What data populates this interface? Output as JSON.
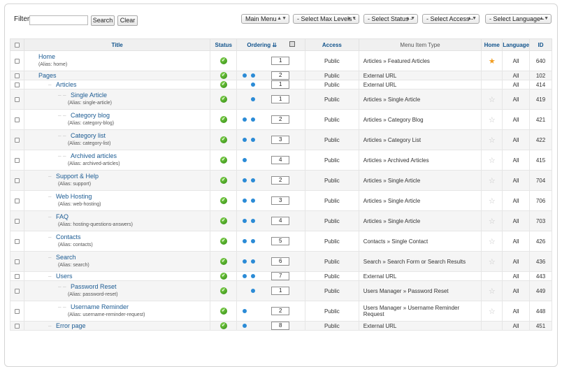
{
  "filter": {
    "label": "Filter:",
    "value": "",
    "search_label": "Search",
    "clear_label": "Clear"
  },
  "selects": {
    "menu": "Main Menu",
    "max_levels": "- Select Max Levels -",
    "status": "- Select Status -",
    "access": "- Select Access -",
    "language": "- Select Language -"
  },
  "columns": {
    "title": "Title",
    "status": "Status",
    "ordering": "Ordering",
    "access": "Access",
    "type": "Menu Item Type",
    "home": "Home",
    "language": "Language",
    "id": "ID"
  },
  "rows": [
    {
      "title": "Home",
      "alias": "(Alias: home)",
      "level": 0,
      "up": false,
      "down": false,
      "order": "1",
      "access": "Public",
      "type": "Articles » Featured Articles",
      "home": "gold",
      "lang": "All",
      "id": "640"
    },
    {
      "title": "Pages",
      "alias": "",
      "level": 0,
      "up": true,
      "down": true,
      "order": "2",
      "access": "Public",
      "type": "External URL",
      "home": "none",
      "lang": "All",
      "id": "102"
    },
    {
      "title": "Articles",
      "alias": "",
      "level": 1,
      "up": false,
      "down": true,
      "order": "1",
      "access": "Public",
      "type": "External URL",
      "home": "none",
      "lang": "All",
      "id": "414"
    },
    {
      "title": "Single Article",
      "alias": "(Alias: single-article)",
      "level": 2,
      "up": false,
      "down": true,
      "order": "1",
      "access": "Public",
      "type": "Articles » Single Article",
      "home": "empty",
      "lang": "All",
      "id": "419"
    },
    {
      "title": "Category blog",
      "alias": "(Alias: category-blog)",
      "level": 2,
      "up": true,
      "down": true,
      "order": "2",
      "access": "Public",
      "type": "Articles » Category Blog",
      "home": "empty",
      "lang": "All",
      "id": "421"
    },
    {
      "title": "Category list",
      "alias": "(Alias: category-list)",
      "level": 2,
      "up": true,
      "down": true,
      "order": "3",
      "access": "Public",
      "type": "Articles » Category List",
      "home": "empty",
      "lang": "All",
      "id": "422"
    },
    {
      "title": "Archived articles",
      "alias": "(Alias: archived-articles)",
      "level": 2,
      "up": true,
      "down": false,
      "order": "4",
      "access": "Public",
      "type": "Articles » Archived Articles",
      "home": "empty",
      "lang": "All",
      "id": "415"
    },
    {
      "title": "Support & Help",
      "alias": "(Alias: support)",
      "level": 1,
      "up": true,
      "down": true,
      "order": "2",
      "access": "Public",
      "type": "Articles » Single Article",
      "home": "empty",
      "lang": "All",
      "id": "704"
    },
    {
      "title": "Web Hosting",
      "alias": "(Alias: web-hosting)",
      "level": 1,
      "up": true,
      "down": true,
      "order": "3",
      "access": "Public",
      "type": "Articles » Single Article",
      "home": "empty",
      "lang": "All",
      "id": "706"
    },
    {
      "title": "FAQ",
      "alias": "(Alias: hosting-questions-answers)",
      "level": 1,
      "up": true,
      "down": true,
      "order": "4",
      "access": "Public",
      "type": "Articles » Single Article",
      "home": "empty",
      "lang": "All",
      "id": "703"
    },
    {
      "title": "Contacts",
      "alias": "(Alias: contacts)",
      "level": 1,
      "up": true,
      "down": true,
      "order": "5",
      "access": "Public",
      "type": "Contacts » Single Contact",
      "home": "empty",
      "lang": "All",
      "id": "426"
    },
    {
      "title": "Search",
      "alias": "(Alias: search)",
      "level": 1,
      "up": true,
      "down": true,
      "order": "6",
      "access": "Public",
      "type": "Search » Search Form or Search Results",
      "home": "empty",
      "lang": "All",
      "id": "436"
    },
    {
      "title": "Users",
      "alias": "",
      "level": 1,
      "up": true,
      "down": true,
      "order": "7",
      "access": "Public",
      "type": "External URL",
      "home": "none",
      "lang": "All",
      "id": "443"
    },
    {
      "title": "Password Reset",
      "alias": "(Alias: password-reset)",
      "level": 2,
      "up": false,
      "down": true,
      "order": "1",
      "access": "Public",
      "type": "Users Manager » Password Reset",
      "home": "empty",
      "lang": "All",
      "id": "449"
    },
    {
      "title": "Username Reminder",
      "alias": "(Alias: username-reminder-request)",
      "level": 2,
      "up": true,
      "down": false,
      "order": "2",
      "access": "Public",
      "type": "Users Manager » Username Reminder Request",
      "home": "empty",
      "lang": "All",
      "id": "448"
    },
    {
      "title": "Error page",
      "alias": "",
      "level": 1,
      "up": true,
      "down": false,
      "order": "8",
      "access": "Public",
      "type": "External URL",
      "home": "none",
      "lang": "All",
      "id": "451"
    }
  ]
}
